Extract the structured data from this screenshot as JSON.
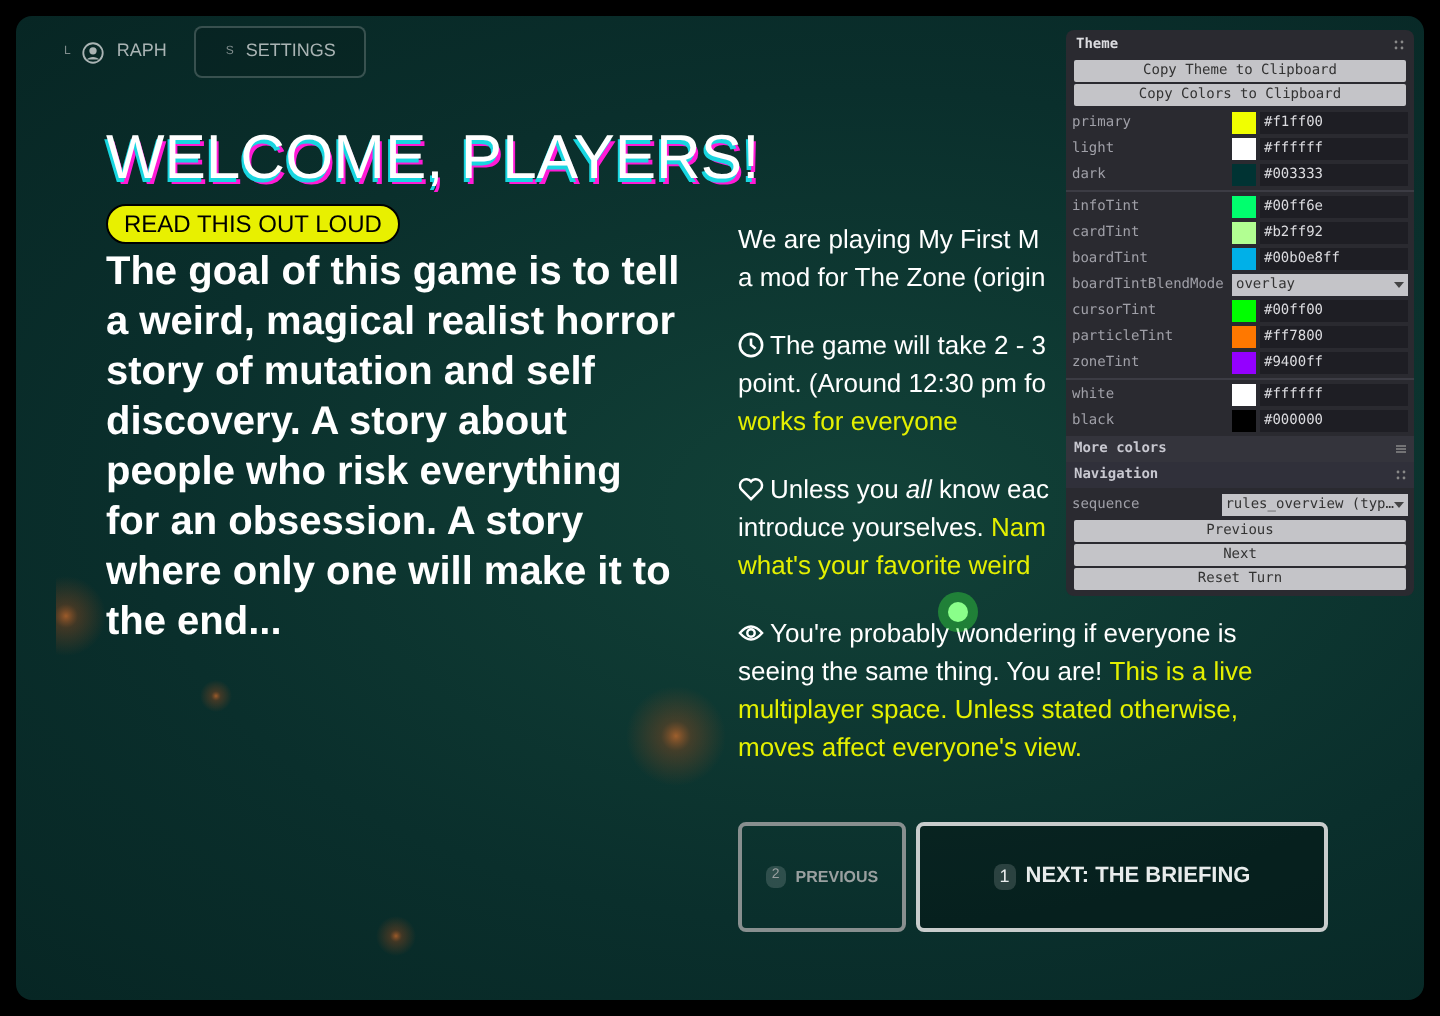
{
  "top_nav": [
    {
      "key": "L",
      "label": "RAPH",
      "kind": "profile",
      "selected": false
    },
    {
      "key": "S",
      "label": "SETTINGS",
      "kind": "button",
      "selected": true
    }
  ],
  "title": "WELCOME, PLAYERS!",
  "badge": "READ THIS OUT LOUD",
  "intro": "The goal of this game is to tell a weird, magical realist horror story of mutation and self discovery. A story about people who risk everything for an obsession. A story where only one will make it to the end...",
  "paragraphs": [
    {
      "lines": [
        [
          {
            "text": "We are playing My First M",
            "highlight": false
          }
        ],
        [
          {
            "text": "a mod for The Zone (origin",
            "highlight": false
          }
        ]
      ]
    },
    {
      "lines": [
        [
          {
            "text": "The game will take 2 - 3",
            "highlight": false
          }
        ],
        [
          {
            "text": "point. (Around 12:30 pm fo",
            "highlight": false
          }
        ],
        [
          {
            "text": "works for everyone",
            "highlight": true
          }
        ]
      ]
    },
    {
      "lines": [
        [
          {
            "text": "Unless you *all* know eac",
            "highlight": false
          }
        ],
        [
          {
            "text": "introduce yourselves. ",
            "highlight": false
          },
          {
            "text": "Nam",
            "highlight": true
          }
        ],
        [
          {
            "text": "what's your favorite weird",
            "highlight": true
          }
        ]
      ]
    },
    {
      "lines": [
        [
          {
            "text": "You're probably wondering if everyone is",
            "highlight": false
          }
        ],
        [
          {
            "text": "seeing the same thing. You are! ",
            "highlight": false
          },
          {
            "text": "This is a live",
            "highlight": true
          }
        ],
        [
          {
            "text": "multiplayer space. Unless stated otherwise,",
            "highlight": true
          }
        ],
        [
          {
            "text": "moves affect everyone's view.",
            "highlight": true
          }
        ]
      ]
    }
  ],
  "nav_buttons": [
    {
      "key": "2",
      "label": "PREVIOUS",
      "primary": false
    },
    {
      "key": "1",
      "label": "NEXT: THE BRIEFING",
      "primary": true
    }
  ],
  "panel": {
    "title": "Theme",
    "actions": [
      "Copy Theme to Clipboard",
      "Copy Colors to Clipboard"
    ],
    "groups": [
      [
        {
          "kind": "color",
          "label": "primary",
          "value": "#f1ff00",
          "color": "#f1ff00"
        },
        {
          "kind": "color",
          "label": "light",
          "value": "#ffffff",
          "color": "#ffffff"
        },
        {
          "kind": "color",
          "label": "dark",
          "value": "#003333",
          "color": "#003333"
        }
      ],
      [
        {
          "kind": "color",
          "label": "infoTint",
          "value": "#00ff6e",
          "color": "#00ff6e"
        },
        {
          "kind": "color",
          "label": "cardTint",
          "value": "#b2ff92",
          "color": "#b2ff92"
        },
        {
          "kind": "color",
          "label": "boardTint",
          "value": "#00b0e8ff",
          "color": "#00b0e8"
        },
        {
          "kind": "select",
          "label": "boardTintBlendMode",
          "value": "overlay"
        },
        {
          "kind": "color",
          "label": "cursorTint",
          "value": "#00ff00",
          "color": "#00ff00"
        },
        {
          "kind": "color",
          "label": "particleTint",
          "value": "#ff7800",
          "color": "#ff7800"
        },
        {
          "kind": "color",
          "label": "zoneTint",
          "value": "#9400ff",
          "color": "#9400ff"
        }
      ],
      [
        {
          "kind": "color",
          "label": "white",
          "value": "#ffffff",
          "color": "#ffffff"
        },
        {
          "kind": "color",
          "label": "black",
          "value": "#000000",
          "color": "#000000"
        }
      ]
    ],
    "folders": [
      {
        "title": "More colors",
        "expanded": false
      },
      {
        "title": "Navigation",
        "expanded": true
      }
    ],
    "sequence": {
      "label": "sequence",
      "value": "rules_overview (typ…"
    },
    "buttons": [
      "Previous",
      "Next",
      "Reset Turn"
    ]
  }
}
